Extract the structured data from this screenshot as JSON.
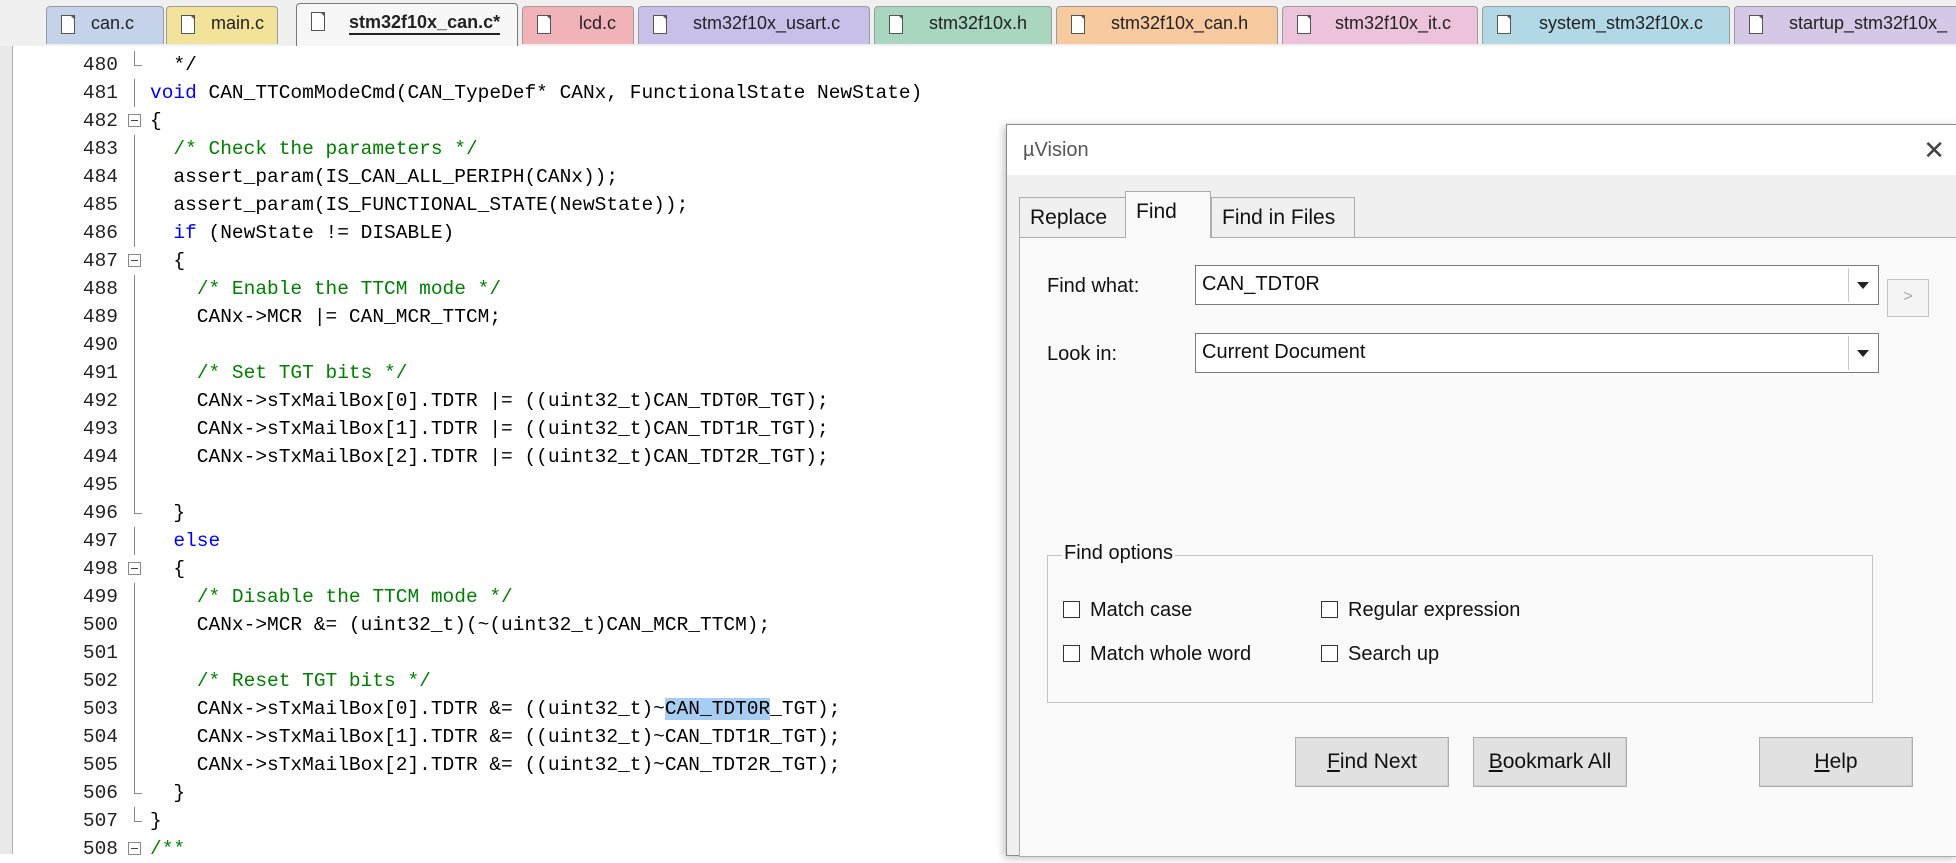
{
  "tabs": [
    {
      "label": "can.c",
      "color": "#c5d3ea",
      "active": false
    },
    {
      "label": "main.c",
      "color": "#f3e29a",
      "active": false
    },
    {
      "label": "stm32f10x_can.c*",
      "color": "#f7f7f7",
      "active": true
    },
    {
      "label": "lcd.c",
      "color": "#f2b3b8",
      "active": false
    },
    {
      "label": "stm32f10x_usart.c",
      "color": "#c9c0ea",
      "active": false
    },
    {
      "label": "stm32f10x.h",
      "color": "#a8d6bf",
      "active": false
    },
    {
      "label": "stm32f10x_can.h",
      "color": "#f8caa0",
      "active": false
    },
    {
      "label": "stm32f10x_it.c",
      "color": "#ecc3da",
      "active": false
    },
    {
      "label": "system_stm32f10x.c",
      "color": "#b2d8e6",
      "active": false
    },
    {
      "label": "startup_stm32f10x_",
      "color": "#d4c8e6",
      "active": false
    }
  ],
  "editor": {
    "lines": [
      {
        "num": "480",
        "html": "  */"
      },
      {
        "num": "481",
        "html": "<span class=\"k\">void</span> CAN_TTComModeCmd(CAN_TypeDef* CANx, FunctionalState NewState)"
      },
      {
        "num": "482",
        "html": "{"
      },
      {
        "num": "483",
        "html": "  <span class=\"c\">/* Check the parameters */</span>"
      },
      {
        "num": "484",
        "html": "  assert_param(IS_CAN_ALL_PERIPH(CANx));"
      },
      {
        "num": "485",
        "html": "  assert_param(IS_FUNCTIONAL_STATE(NewState));"
      },
      {
        "num": "486",
        "html": "  <span class=\"k\">if</span> (NewState != DISABLE)"
      },
      {
        "num": "487",
        "html": "  {"
      },
      {
        "num": "488",
        "html": "    <span class=\"c\">/* Enable the TTCM mode */</span>"
      },
      {
        "num": "489",
        "html": "    CANx->MCR |= CAN_MCR_TTCM;"
      },
      {
        "num": "490",
        "html": ""
      },
      {
        "num": "491",
        "html": "    <span class=\"c\">/* Set TGT bits */</span>"
      },
      {
        "num": "492",
        "html": "    CANx->sTxMailBox[0].TDTR |= ((uint32_t)CAN_TDT0R_TGT);"
      },
      {
        "num": "493",
        "html": "    CANx->sTxMailBox[1].TDTR |= ((uint32_t)CAN_TDT1R_TGT);"
      },
      {
        "num": "494",
        "html": "    CANx->sTxMailBox[2].TDTR |= ((uint32_t)CAN_TDT2R_TGT);"
      },
      {
        "num": "495",
        "html": ""
      },
      {
        "num": "496",
        "html": "  }"
      },
      {
        "num": "497",
        "html": "  <span class=\"k\">else</span>"
      },
      {
        "num": "498",
        "html": "  {"
      },
      {
        "num": "499",
        "html": "    <span class=\"c\">/* Disable the TTCM mode */</span>"
      },
      {
        "num": "500",
        "html": "    CANx->MCR &amp;= (uint32_t)(~(uint32_t)CAN_MCR_TTCM);"
      },
      {
        "num": "501",
        "html": ""
      },
      {
        "num": "502",
        "html": "    <span class=\"c\">/* Reset TGT bits */</span>"
      },
      {
        "num": "503",
        "html": "    CANx->sTxMailBox[0].TDTR &amp;= ((uint32_t)~<span class=\"sel\">CAN_TDT0R</span>_TGT);"
      },
      {
        "num": "504",
        "html": "    CANx->sTxMailBox[1].TDTR &amp;= ((uint32_t)~CAN_TDT1R_TGT);"
      },
      {
        "num": "505",
        "html": "    CANx->sTxMailBox[2].TDTR &amp;= ((uint32_t)~CAN_TDT2R_TGT);"
      },
      {
        "num": "506",
        "html": "  }"
      },
      {
        "num": "507",
        "html": "}"
      },
      {
        "num": "508",
        "html": "<span class=\"c\">/**</span>"
      }
    ],
    "fold_markers": {
      "482": "box",
      "487": "box",
      "498": "box",
      "508": "box",
      "480": "end",
      "496": "end",
      "506": "end",
      "507": "end"
    }
  },
  "dialog": {
    "title": "µVision",
    "close_glyph": "✕",
    "tabs": [
      "Replace",
      "Find",
      "Find in Files"
    ],
    "find_what_label": "Find what:",
    "find_what_value": "CAN_TDT0R",
    "look_in_label": "Look in:",
    "look_in_value": "Current Document",
    "side_button": ">",
    "options_title": "Find options",
    "options": {
      "match_case": "Match case",
      "regular_expression": "Regular expression",
      "match_whole_word": "Match whole word",
      "search_up": "Search up"
    },
    "buttons": {
      "find_next": {
        "mnemonic": "F",
        "rest": "ind Next"
      },
      "bookmark_all": {
        "mnemonic": "B",
        "rest": "ookmark All"
      },
      "help": {
        "mnemonic": "H",
        "rest": "elp"
      }
    }
  }
}
